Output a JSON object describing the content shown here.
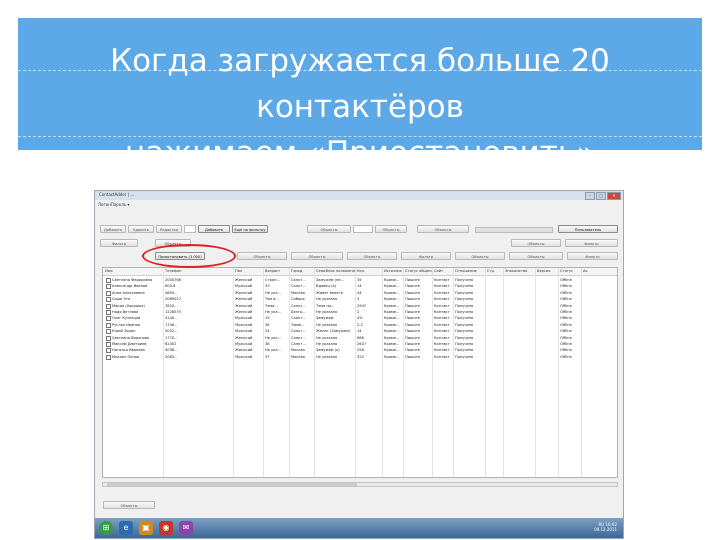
{
  "slide": {
    "title_line1": "Когда загружается больше 20 контактёров",
    "title_line2": "нажимаем «Приостановить»"
  },
  "window": {
    "title": "ContactAdder | ...",
    "menu": "ЛогинПароль ▾",
    "btn_min": "–",
    "btn_max": "□",
    "btn_close": "✕"
  },
  "toolbar1": [
    "Добавить",
    "Удалить",
    "Редактор",
    "Добавить",
    "Ещё по фильтру",
    "Объекты"
  ],
  "toolbar2": [
    "Фильтр",
    "Объекты",
    "Объекты",
    "Объекты",
    "Объекты"
  ],
  "toolbar_right": [
    "Пользователь",
    "Объекты",
    "Фильтр",
    "Объекты",
    "Фильтр",
    "Объекты"
  ],
  "pause_button": "Приостановить",
  "pause_button_count": "(3 000)",
  "grid_headers": [
    "Имя",
    "Телефон",
    "Пол",
    "Возраст",
    "Город",
    "Семейное положение",
    "Кол.",
    "Источник",
    "Статус общения",
    "Сайт",
    "Отношение",
    "Стр.",
    "Знакомство",
    "Версия",
    "Статус",
    "Ак"
  ],
  "rows": [
    [
      "Светлана Федоровна",
      "2000766",
      "Женский",
      "Стран...",
      "Санкт...",
      "Замужем (не...",
      "35",
      "Кроме...",
      "Пишите",
      "Контакт",
      "Получено",
      "",
      "",
      "",
      "Offline"
    ],
    [
      "Александр Иванов",
      "600-6",
      "Мужской",
      "33",
      "Санкт...",
      "Вдовец (а)",
      "14",
      "Кроме...",
      "Пишите",
      "Контакт",
      "Получено",
      "",
      "",
      "",
      "Offline"
    ],
    [
      "Анна Алексеевна",
      "4695...",
      "Женский",
      "Не ука...",
      "Москва",
      "Живет вместе",
      "44",
      "Кроме...",
      "Пишите",
      "Контакт",
      "Получено",
      "",
      "",
      "",
      "Offline"
    ],
    [
      "Саша Эта",
      "2069027",
      "Женский",
      "Тем в...",
      "Сибирь",
      "Не указано",
      "3",
      "Кроме...",
      "Пишите",
      "Контакт",
      "Получено",
      "",
      "",
      "",
      "Offline"
    ],
    [
      "Мария (Хорошая)",
      "7820...",
      "Женский",
      "Тема...",
      "Санкт...",
      "Тема на...",
      "2947",
      "Кроме...",
      "Пишите",
      "Контакт",
      "Получено",
      "",
      "",
      "",
      "Offline"
    ],
    [
      "Надя Ветлова",
      "1228575",
      "Женский",
      "Не ука...",
      "Белго...",
      "Не указано",
      "2",
      "Кроме...",
      "Пишите",
      "Контакт",
      "Получено",
      "",
      "",
      "",
      "Offline"
    ],
    [
      "Олег Кузнецов",
      "4140...",
      "Мужской",
      "19",
      "Санкт...",
      "Замужем",
      "4%",
      "Кроме...",
      "Пишите",
      "Контакт",
      "Получено",
      "",
      "",
      "",
      "Offline"
    ],
    [
      "Руслан Иванов",
      "1706...",
      "Мужской",
      "36",
      "Тюме...",
      "Не указано",
      "2-2",
      "Кроме...",
      "Пишите",
      "Контакт",
      "Получено",
      "",
      "",
      "",
      "Offline"
    ],
    [
      "Юрий Зорин",
      "5052...",
      "Мужской",
      "24",
      "Санкт...",
      "Женат (Замужем)",
      "14",
      "Кроме...",
      "Пишите",
      "Контакт",
      "Получено",
      "",
      "",
      "",
      "Offline"
    ],
    [
      "Светлана Воронова",
      "1770...",
      "Женский",
      "Не ука...",
      "Санкт...",
      "Не указано",
      "666",
      "Кроме...",
      "Пишите",
      "Контакт",
      "Получено",
      "",
      "",
      "",
      "Offline"
    ],
    [
      "Максим Дмитриев",
      "62402",
      "Мужской",
      "38",
      "Санкт...",
      "Не указано",
      "2607",
      "Кроме...",
      "Пишите",
      "Контакт",
      "Получено",
      "",
      "",
      "",
      "Offline"
    ],
    [
      "Наталья Иванова",
      "3038...",
      "Женский",
      "Не ука...",
      "Москва",
      "Замужем (а)",
      "258",
      "Кроме...",
      "Пишите",
      "Контакт",
      "Получено",
      "",
      "",
      "",
      "Offline"
    ],
    [
      "Михаил Попов",
      "2083...",
      "Мужской",
      "37",
      "Москва",
      "Не указано",
      "320",
      "Кроме...",
      "Пишите",
      "Контакт",
      "Получено",
      "",
      "",
      "",
      "Offline"
    ]
  ],
  "bottom_button": "Объекты",
  "taskbar": {
    "icons": [
      "⊞",
      "e",
      "▣",
      "◉",
      "✉"
    ],
    "lang": "RU",
    "time": "16:02",
    "date": "09.12.2011"
  },
  "colors": {
    "banner": "#5da8e6",
    "highlight": "#e02020"
  }
}
